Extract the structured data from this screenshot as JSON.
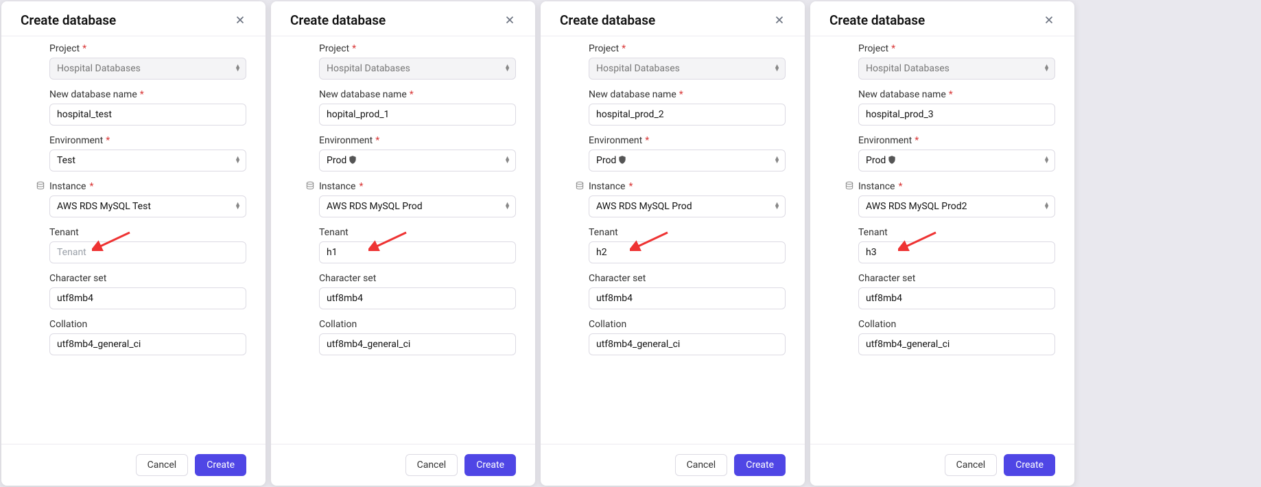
{
  "modals": [
    {
      "title": "Create database",
      "project_label": "Project",
      "project_value": "Hospital Databases",
      "dbname_label": "New database name",
      "dbname_value": "hospital_test",
      "env_label": "Environment",
      "env_value": "Test",
      "env_shield": false,
      "instance_label": "Instance",
      "instance_value": "AWS RDS MySQL Test",
      "tenant_label": "Tenant",
      "tenant_value": "",
      "tenant_placeholder": "Tenant",
      "charset_label": "Character set",
      "charset_value": "utf8mb4",
      "collation_label": "Collation",
      "collation_value": "utf8mb4_general_ci",
      "cancel": "Cancel",
      "create": "Create"
    },
    {
      "title": "Create database",
      "project_label": "Project",
      "project_value": "Hospital Databases",
      "dbname_label": "New database name",
      "dbname_value": "hopital_prod_1",
      "env_label": "Environment",
      "env_value": "Prod",
      "env_shield": true,
      "instance_label": "Instance",
      "instance_value": "AWS RDS MySQL Prod",
      "tenant_label": "Tenant",
      "tenant_value": "h1",
      "tenant_placeholder": "Tenant",
      "charset_label": "Character set",
      "charset_value": "utf8mb4",
      "collation_label": "Collation",
      "collation_value": "utf8mb4_general_ci",
      "cancel": "Cancel",
      "create": "Create"
    },
    {
      "title": "Create database",
      "project_label": "Project",
      "project_value": "Hospital Databases",
      "dbname_label": "New database name",
      "dbname_value": "hospital_prod_2",
      "env_label": "Environment",
      "env_value": "Prod",
      "env_shield": true,
      "instance_label": "Instance",
      "instance_value": "AWS RDS MySQL Prod",
      "tenant_label": "Tenant",
      "tenant_value": "h2",
      "tenant_placeholder": "Tenant",
      "charset_label": "Character set",
      "charset_value": "utf8mb4",
      "collation_label": "Collation",
      "collation_value": "utf8mb4_general_ci",
      "cancel": "Cancel",
      "create": "Create"
    },
    {
      "title": "Create database",
      "project_label": "Project",
      "project_value": "Hospital Databases",
      "dbname_label": "New database name",
      "dbname_value": "hospital_prod_3",
      "env_label": "Environment",
      "env_value": "Prod",
      "env_shield": true,
      "instance_label": "Instance",
      "instance_value": "AWS RDS MySQL Prod2",
      "tenant_label": "Tenant",
      "tenant_value": "h3",
      "tenant_placeholder": "Tenant",
      "charset_label": "Character set",
      "charset_value": "utf8mb4",
      "collation_label": "Collation",
      "collation_value": "utf8mb4_general_ci",
      "cancel": "Cancel",
      "create": "Create"
    }
  ]
}
